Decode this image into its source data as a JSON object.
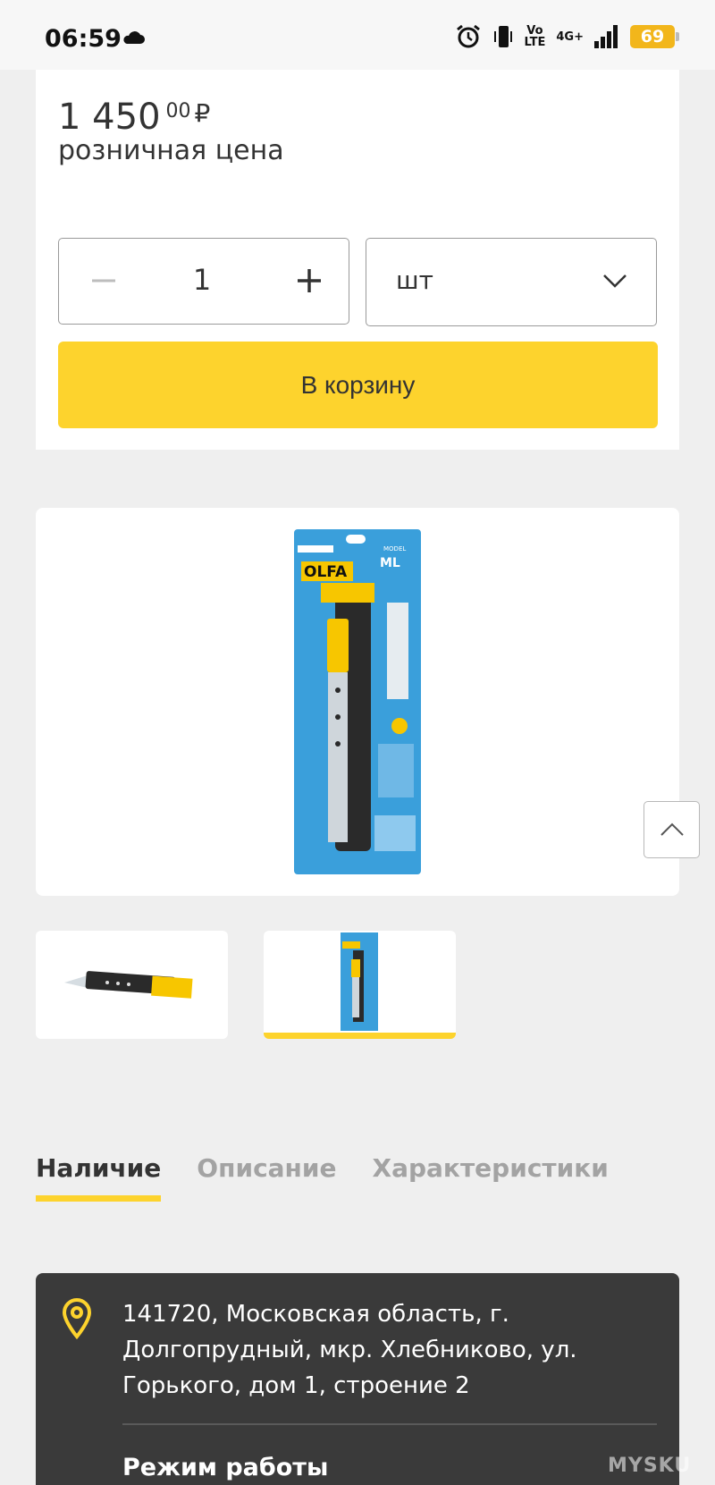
{
  "status_bar": {
    "time": "06:59",
    "volte_top": "Vo",
    "volte_bottom": "LTE",
    "network": "4G+",
    "battery": "69"
  },
  "product": {
    "price_main": "1 450",
    "price_cents": "00",
    "currency": "₽",
    "price_label": "розничная цена",
    "quantity": "1",
    "unit": "шт",
    "add_to_cart_label": "В корзину",
    "package_brand": "OLFA",
    "package_model": "ML"
  },
  "tabs": [
    {
      "label": "Наличие",
      "active": true
    },
    {
      "label": "Описание",
      "active": false
    },
    {
      "label": "Характеристики",
      "active": false
    }
  ],
  "store": {
    "address": "141720, Московская область, г. Долгопрудный, мкр. Хлебниково, ул. Горького, дом 1, строение 2",
    "hours_title": "Режим работы"
  },
  "watermark": "MYSKU",
  "colors": {
    "accent": "#fdd32d",
    "dark_card": "#3a3a3a",
    "package_blue": "#3a9fdb"
  }
}
